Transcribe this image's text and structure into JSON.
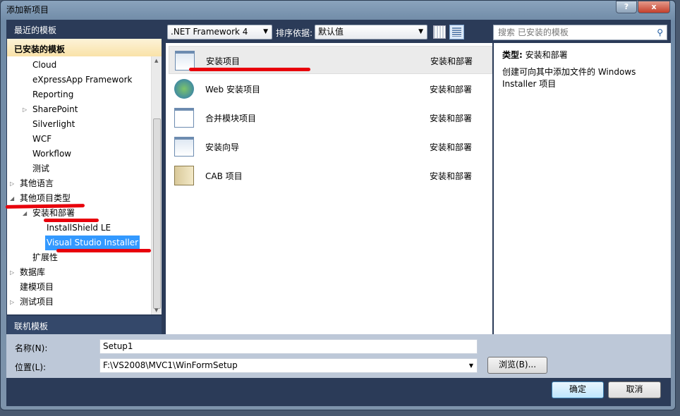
{
  "window": {
    "title": "添加新项目",
    "help_label": "?",
    "close_label": "x"
  },
  "sidebar": {
    "recent": "最近的模板",
    "installed": "已安装的模板",
    "online": "联机模板",
    "tree": [
      {
        "label": "Cloud",
        "level": 2,
        "arrow": ""
      },
      {
        "label": "eXpressApp Framework",
        "level": 2,
        "arrow": ""
      },
      {
        "label": "Reporting",
        "level": 2,
        "arrow": ""
      },
      {
        "label": "SharePoint",
        "level": 2,
        "arrow": "▷"
      },
      {
        "label": "Silverlight",
        "level": 2,
        "arrow": ""
      },
      {
        "label": "WCF",
        "level": 2,
        "arrow": ""
      },
      {
        "label": "Workflow",
        "level": 2,
        "arrow": ""
      },
      {
        "label": "测试",
        "level": 2,
        "arrow": ""
      },
      {
        "label": "其他语言",
        "level": 1,
        "arrow": "▷"
      },
      {
        "label": "其他项目类型",
        "level": 1,
        "arrow": "◢"
      },
      {
        "label": "安装和部署",
        "level": 2,
        "arrow": "◢"
      },
      {
        "label": "InstallShield LE",
        "level": 3,
        "arrow": ""
      },
      {
        "label": "Visual Studio Installer",
        "level": 3,
        "arrow": "",
        "selected": true
      },
      {
        "label": "扩展性",
        "level": 2,
        "arrow": ""
      },
      {
        "label": "数据库",
        "level": 1,
        "arrow": "▷"
      },
      {
        "label": "建模项目",
        "level": 1,
        "arrow": ""
      },
      {
        "label": "测试项目",
        "level": 1,
        "arrow": "▷"
      }
    ]
  },
  "toolbar": {
    "framework": ".NET Framework 4",
    "sort_label": "排序依据:",
    "sort_value": "默认值",
    "search_placeholder": "搜索 已安装的模板"
  },
  "templates": [
    {
      "name": "安装项目",
      "category": "安装和部署",
      "icon": "setup-project-icon",
      "selected": true
    },
    {
      "name": "Web 安装项目",
      "category": "安装和部署",
      "icon": "web-setup-icon"
    },
    {
      "name": "合并模块项目",
      "category": "安装和部署",
      "icon": "merge-module-icon"
    },
    {
      "name": "安装向导",
      "category": "安装和部署",
      "icon": "setup-wizard-icon"
    },
    {
      "name": "CAB 项目",
      "category": "安装和部署",
      "icon": "cab-project-icon"
    }
  ],
  "description": {
    "type_label": "类型:",
    "type_value": "安装和部署",
    "text": "创建可向其中添加文件的 Windows Installer 项目"
  },
  "form": {
    "name_label": "名称(N):",
    "name_value": "Setup1",
    "location_label": "位置(L):",
    "location_value": "F:\\VS2008\\MVC1\\WinFormSetup",
    "browse_label": "浏览(B)..."
  },
  "buttons": {
    "ok": "确定",
    "cancel": "取消"
  },
  "colors": {
    "navy": "#2b3b58",
    "selection": "#3399ff",
    "annotation": "#e8000b"
  }
}
